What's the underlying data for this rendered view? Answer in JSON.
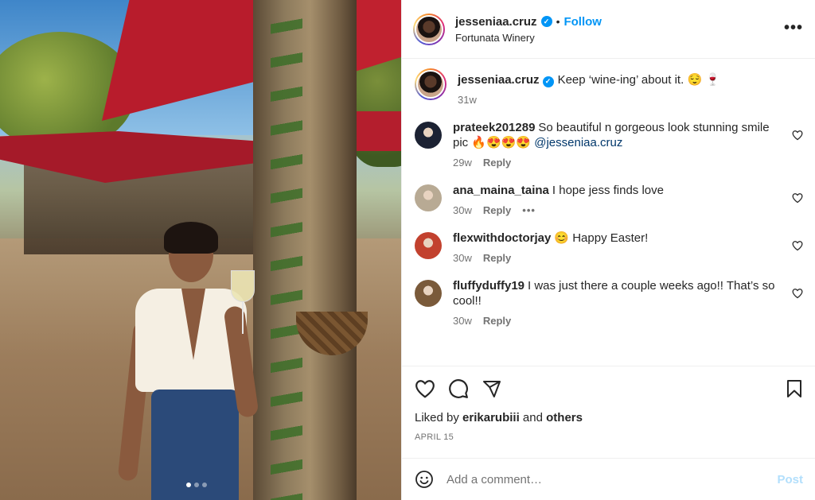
{
  "post": {
    "username": "jesseniaa.cruz",
    "separator": "•",
    "follow_label": "Follow",
    "location": "Fortunata Winery",
    "more_icon": "more-horizontal-icon",
    "verified_icon": "verified-badge-icon",
    "carousel": {
      "count": 3,
      "active_index": 0
    }
  },
  "caption": {
    "username": "jesseniaa.cruz",
    "text": "Keep ‘wine-ing’ about it. 😌 🍷",
    "age": "31w"
  },
  "comments": [
    {
      "username": "prateek201289",
      "text": "So beautiful n gorgeous look stunning smile pic 🔥😍😍😍",
      "mention": "@jesseniaa.cruz",
      "age": "29w",
      "reply_label": "Reply",
      "avatar_color": "#1c2233"
    },
    {
      "username": "ana_maina_taina",
      "text": "I hope jess finds love",
      "mention": "",
      "age": "30w",
      "reply_label": "Reply",
      "more_label": "•••",
      "avatar_color": "#b8aa94"
    },
    {
      "username": "flexwithdoctorjay",
      "text": "😊 Happy Easter!",
      "mention": "",
      "age": "30w",
      "reply_label": "Reply",
      "avatar_color": "#c2412e"
    },
    {
      "username": "fluffyduffy19",
      "text": "I was just there a couple weeks ago!! That’s so cool!!",
      "mention": "",
      "age": "30w",
      "reply_label": "Reply",
      "avatar_color": "#7a5a3a"
    }
  ],
  "actions": {
    "icons": [
      "heart-icon",
      "comment-icon",
      "share-icon",
      "bookmark-icon"
    ],
    "liked_by_prefix": "Liked by",
    "liked_by_user": "erikarubiii",
    "liked_by_and": "and",
    "liked_by_others": "others",
    "date": "APRIL 15"
  },
  "add_comment": {
    "emoji_icon": "emoji-icon",
    "placeholder": "Add a comment…",
    "post_label": "Post"
  },
  "colors": {
    "accent": "#0095f6",
    "post_disabled": "#b2dffc",
    "muted": "#737373",
    "text": "#262626"
  }
}
